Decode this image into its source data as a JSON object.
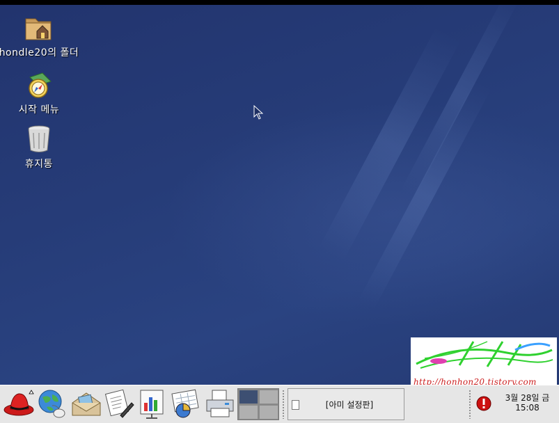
{
  "desktop": {
    "icons": [
      {
        "label": "hondle20의 폴더",
        "icon": "home-folder-icon"
      },
      {
        "label": "시작 메뉴",
        "icon": "start-here-icon"
      },
      {
        "label": "휴지통",
        "icon": "trash-icon"
      }
    ],
    "watermark": {
      "text": "http://honhon20.tistory.com"
    }
  },
  "panel": {
    "launchers": [
      {
        "name": "redhat-main-menu",
        "icon": "red-hat-icon"
      },
      {
        "name": "web-browser",
        "icon": "globe-mouse-icon"
      },
      {
        "name": "email",
        "icon": "mail-envelope-icon"
      },
      {
        "name": "word-processor",
        "icon": "document-pen-icon"
      },
      {
        "name": "presentation",
        "icon": "presentation-chart-icon"
      },
      {
        "name": "spreadsheet",
        "icon": "spreadsheet-pie-icon"
      },
      {
        "name": "print-manager",
        "icon": "printer-icon"
      }
    ],
    "task": {
      "label": "[아미 설정판]"
    },
    "clock": {
      "date": "3월 28일 금",
      "time": "15:08"
    },
    "colors": {
      "alert": "#cc1111",
      "active_workspace": "#3d4f72"
    }
  }
}
